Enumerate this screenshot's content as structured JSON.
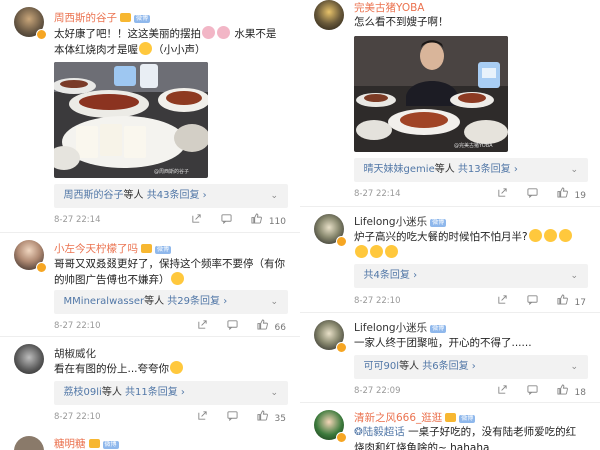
{
  "left": {
    "comments": [
      {
        "name": "周西斯的谷子",
        "text": "太好康了吧！！这这美丽的摆拍",
        "text_tail": "水果不是本体红烧肉才是喔",
        "text_end": "（小小声）",
        "photo_watermark": "@周西斯的谷子",
        "replies_user": "周西斯的谷子",
        "replies_mid": "等人",
        "replies_count": "共43条回复",
        "time": "8-27 22:14",
        "likes": "110"
      },
      {
        "name": "小左今天柠檬了吗",
        "text": "哥哥又双叒叕更好了，保持这个频率不要停（有你的帅图广告傅也不嫌弃）",
        "replies_user": "MMineralwasser",
        "replies_mid": "等人",
        "replies_count": "共29条回复",
        "time": "8-27 22:10",
        "likes": "66"
      },
      {
        "name": "胡椒威化",
        "text": "看在有图的份上...夸夸你",
        "replies_user": "荔枝09li",
        "replies_mid": "等人",
        "replies_count": "共11条回复",
        "time": "8-27 22:10",
        "likes": "35"
      },
      {
        "name": "糖明糖"
      }
    ]
  },
  "right": {
    "comments": [
      {
        "name": "完美古猪YOBA",
        "text": "怎么看不到嫂子啊！",
        "photo_watermark": "@完美古猪YOBA",
        "replies_user": "晴天妹妹gemie",
        "replies_mid": "等人",
        "replies_count": "共13条回复",
        "time": "8-27 22:14",
        "likes": "19"
      },
      {
        "name": "Lifelong小迷乐",
        "text": "炉子高兴的吃大餐的时候怕不怕月半?",
        "replies_count": "共4条回复",
        "time": "8-27 22:10",
        "likes": "17"
      },
      {
        "name": "Lifelong小迷乐",
        "text": "一家人终于团聚啦，开心的不得了......",
        "replies_user": "可可90l",
        "replies_mid": "等人",
        "replies_count": "共6条回复",
        "time": "8-27 22:09",
        "likes": "18"
      },
      {
        "name": "清新之风666_逛逛",
        "topic": "❂陆毅超话",
        "text": "一桌子好吃的，没有陆老师爱吃的红",
        "text_cut": "烧肉和红烧鱼啥的~ hahaha"
      }
    ]
  },
  "badge_label": "微博",
  "colors": {
    "name": "#eb7350",
    "link": "#5177a7",
    "reply_bg": "#f2f2f2",
    "time": "#999999"
  },
  "icons": [
    "share-icon",
    "comment-icon",
    "like-icon",
    "chevron-right-icon",
    "vip-badge-icon",
    "crown-icon"
  ]
}
